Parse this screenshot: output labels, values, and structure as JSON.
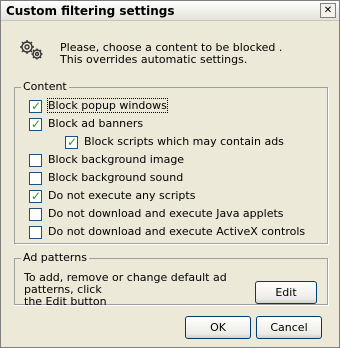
{
  "window": {
    "title": "Custom filtering settings",
    "close_glyph": "✕"
  },
  "intro": {
    "icon": "gears-icon",
    "line1": "Please, choose a content to be blocked .",
    "line2": "This overrides automatic settings."
  },
  "content_group": {
    "legend": "Content",
    "items": [
      {
        "label": "Block popup windows",
        "checked": true
      },
      {
        "label": "Block ad banners",
        "checked": true
      },
      {
        "label": "Block scripts which may contain ads",
        "checked": true
      },
      {
        "label": "Block background image",
        "checked": false
      },
      {
        "label": "Block background sound",
        "checked": false
      },
      {
        "label": "Do not execute any scripts",
        "checked": true
      },
      {
        "label": "Do not download and execute Java applets",
        "checked": false
      },
      {
        "label": "Do not download and execute ActiveX controls",
        "checked": false
      }
    ]
  },
  "ad_patterns": {
    "legend": "Ad patterns",
    "line1": "To add, remove or change default ad patterns, click",
    "line2": "the Edit button",
    "edit_label": "Edit"
  },
  "buttons": {
    "ok_label": "OK",
    "cancel_label": "Cancel"
  },
  "colors": {
    "checkmark": "#21A121",
    "button_border": "#003C74",
    "dialog_bg": "#ECE9D8"
  }
}
